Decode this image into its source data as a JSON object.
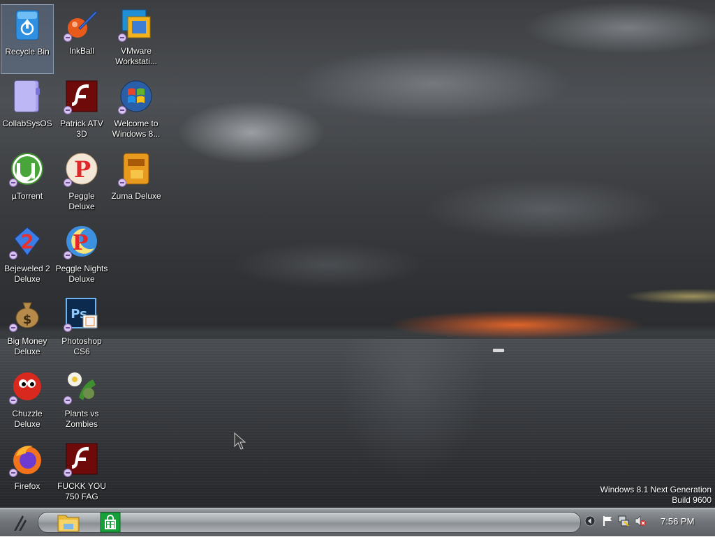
{
  "desktop": {
    "icons": [
      {
        "label": "Recycle Bin",
        "icon": "recycle-bin-icon",
        "selected": true
      },
      {
        "label": "InkBall",
        "icon": "inkball-icon"
      },
      {
        "label": "VMware\nWorkstati...",
        "icon": "vmware-icon"
      },
      {
        "label": "CollabSysOS",
        "icon": "folder-icon"
      },
      {
        "label": "Patrick ATV\n3D",
        "icon": "flash-icon"
      },
      {
        "label": "Welcome to\nWindows 8...",
        "icon": "windows-logo-icon"
      },
      {
        "label": "µTorrent",
        "icon": "utorrent-icon"
      },
      {
        "label": "Peggle Deluxe",
        "icon": "peggle-icon"
      },
      {
        "label": "Zuma Deluxe",
        "icon": "zuma-icon"
      },
      {
        "label": "Bejeweled 2\nDeluxe",
        "icon": "bejeweled-icon"
      },
      {
        "label": "Peggle Nights\nDeluxe",
        "icon": "peggle-nights-icon"
      },
      {
        "label": "Big Money\nDeluxe",
        "icon": "money-bag-icon"
      },
      {
        "label": "Photoshop\nCS6",
        "icon": "photoshop-icon"
      },
      {
        "label": "Chuzzle\nDeluxe",
        "icon": "chuzzle-icon"
      },
      {
        "label": "Plants vs\nZombies",
        "icon": "plants-vs-zombies-icon"
      },
      {
        "label": "Firefox",
        "icon": "firefox-icon"
      },
      {
        "label": "FUCKK YOU\n750 FAG",
        "icon": "flash-icon"
      }
    ]
  },
  "watermark": {
    "line1": "Windows 8.1 Next Generation",
    "line2": "Build 9600"
  },
  "taskbar": {
    "pinned": [
      {
        "name": "file-explorer",
        "icon": "folder-icon"
      },
      {
        "name": "store",
        "icon": "store-icon"
      }
    ],
    "tray": [
      "show-hidden-icons",
      "action-center-flag-icon",
      "network-icon",
      "volume-muted-icon"
    ],
    "clock": "7:56 PM"
  },
  "colors": {
    "sunset": "#ff6e28",
    "taskbar": "#6f7378",
    "shortcut_badge": "#d9c6ee"
  }
}
